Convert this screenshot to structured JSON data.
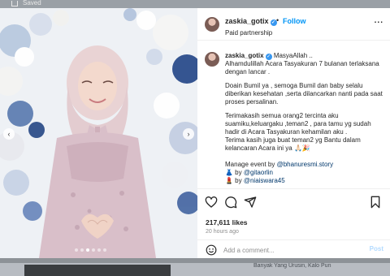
{
  "browser": {
    "saved_label": "Saved"
  },
  "post": {
    "header": {
      "username": "zaskia_gotix",
      "separator": "•",
      "follow_label": "Follow",
      "paid_partnership": "Paid partnership",
      "more_label": "..."
    },
    "caption": {
      "username": "zaskia_gotix",
      "paragraphs": [
        "MasyaAllah ..\nAlhamdulillah Acara Tasyakuran 7 bulanan terlaksana dengan lancar .",
        "Doain Bumil ya , semoga Bumil dan baby selalu diberikan kesehatan ,serta dilancarkan nanti pada saat proses persalinan.",
        "Terimakasih semua orang2 tercinta aku suamiku,keluargaku ,teman2 , para tamu yg sudah hadir di Acara Tasyakuran kehamilan aku .\nTerima kasih juga buat teman2 yg Bantu dalam kelancaran Acara ini ya 🙏🏻🎉"
      ],
      "manage_label": "Manage event by ",
      "manage_mention": "@bhanuresmi.story",
      "credit1_prefix": "👗 by ",
      "credit1_mention": "@gitaorlin",
      "credit2_prefix": "💄 by ",
      "credit2_mention": "@niaiswara45"
    },
    "likes": "217,611 likes",
    "time": "20 hours ago",
    "comment_placeholder": "Add a comment...",
    "post_label": "Post",
    "carousel": {
      "slide_count": 6,
      "active_index": 2
    }
  },
  "page_below": {
    "overflow_text": "Banyak Yang Urusin, Kalo Pun"
  },
  "colors": {
    "accent": "#0095f6",
    "link": "#00376b",
    "dress": "#d9bfc9",
    "hijab": "#ead6d8"
  }
}
